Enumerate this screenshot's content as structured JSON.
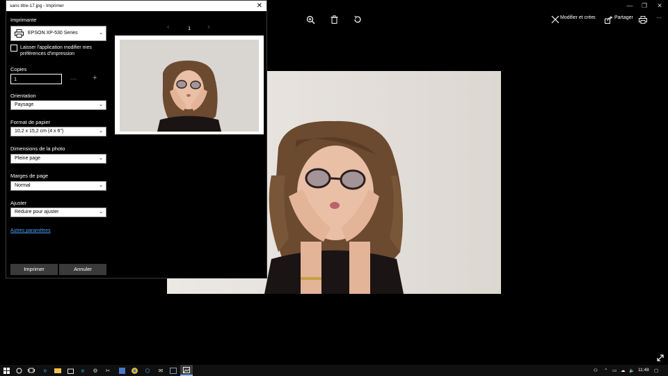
{
  "dialog": {
    "title": "sans titre-17.jpg - Imprimer",
    "close_glyph": "✕",
    "printer_label": "Imprimante",
    "printer_value": "EPSON XP-530 Series",
    "allow_app_checkbox_label_line1": "Laisser l'application modifier mes",
    "allow_app_checkbox_label_line2": "préférences d'impression",
    "copies_label": "Copies",
    "copies_value": "1",
    "copies_minus": "—",
    "copies_plus": "+",
    "orientation_label": "Orientation",
    "orientation_value": "Paysage",
    "paper_size_label": "Format de papier",
    "paper_size_value": "10,2 x 15,2 cm (4 x 6\")",
    "photo_size_label": "Dimensions de la photo",
    "photo_size_value": "Pleine page",
    "margins_label": "Marges de page",
    "margins_value": "Normal",
    "fit_label": "Ajuster",
    "fit_value": "Réduire pour ajuster",
    "more_settings_link": "Autres paramètres",
    "print_button": "Imprimer",
    "cancel_button": "Annuler",
    "page_number": "1",
    "prev_glyph": "‹",
    "next_glyph": "›"
  },
  "toolbar": {
    "edit_create_label": "Modifier et créer",
    "share_label": "Partager",
    "more_glyph": "···"
  },
  "window_controls": {
    "minimize": "—",
    "restore": "❐",
    "close": "✕"
  },
  "taskbar": {
    "time": "11:48"
  },
  "colors": {
    "link": "#4ea3ff",
    "dialog_bg": "#000000",
    "button_bg": "#3a3a3a"
  }
}
